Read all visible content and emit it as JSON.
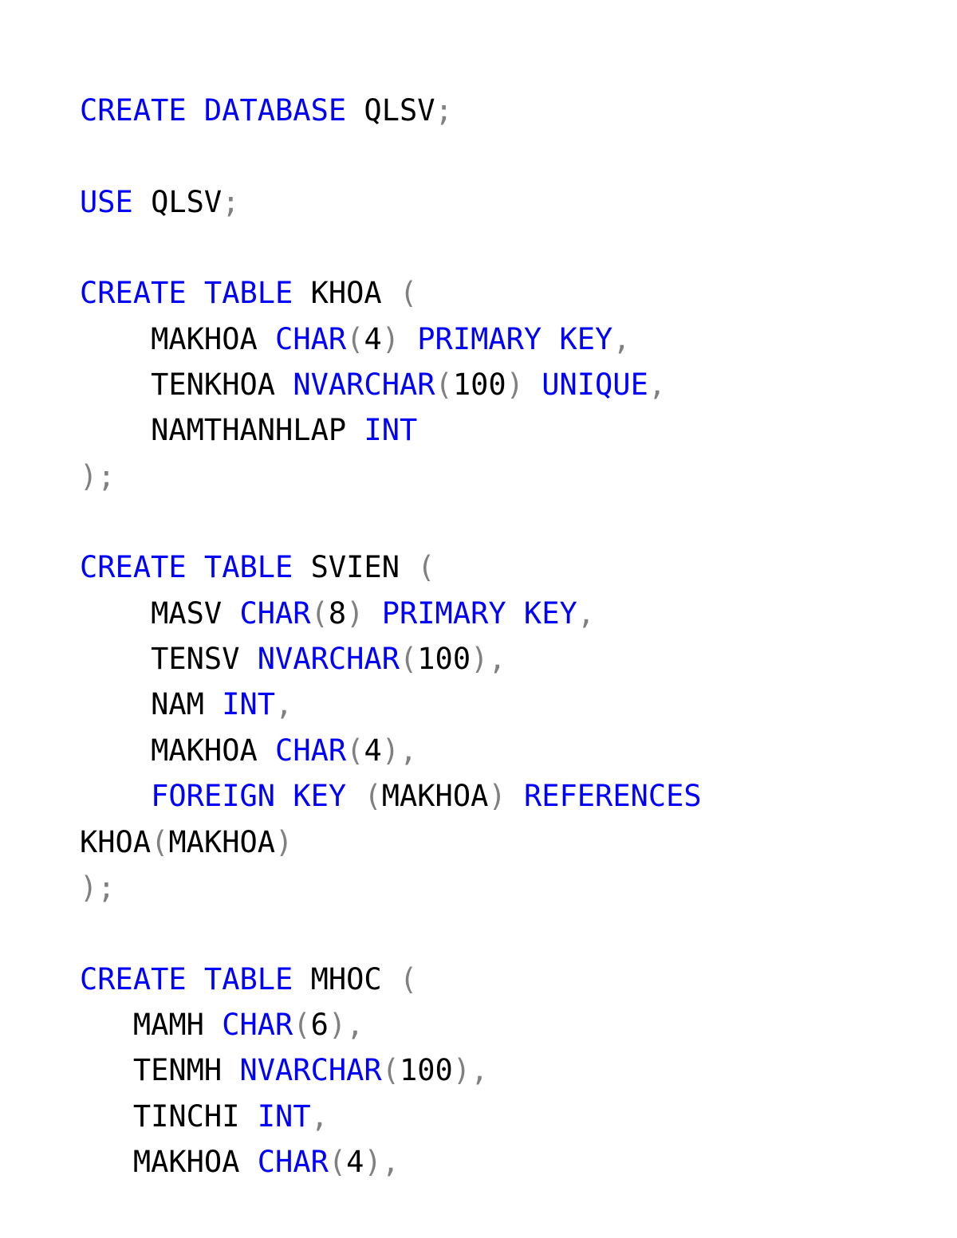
{
  "tokens": [
    [
      [
        "CREATE DATABASE",
        "kw"
      ],
      [
        " QLSV",
        "id"
      ],
      [
        ";",
        "pn"
      ]
    ],
    [],
    [
      [
        "USE",
        "kw"
      ],
      [
        " QLSV",
        "id"
      ],
      [
        ";",
        "pn"
      ]
    ],
    [],
    [
      [
        "CREATE TABLE",
        "kw"
      ],
      [
        " KHOA ",
        "id"
      ],
      [
        "(",
        "pn"
      ]
    ],
    [
      [
        "    MAKHOA ",
        "id"
      ],
      [
        "CHAR",
        "kw"
      ],
      [
        "(",
        "pn"
      ],
      [
        "4",
        "id"
      ],
      [
        ")",
        "pn"
      ],
      [
        " ",
        "id"
      ],
      [
        "PRIMARY KEY",
        "kw"
      ],
      [
        ",",
        "pn"
      ]
    ],
    [
      [
        "    TENKHOA ",
        "id"
      ],
      [
        "NVARCHAR",
        "kw"
      ],
      [
        "(",
        "pn"
      ],
      [
        "100",
        "id"
      ],
      [
        ")",
        "pn"
      ],
      [
        " ",
        "id"
      ],
      [
        "UNIQUE",
        "kw"
      ],
      [
        ",",
        "pn"
      ]
    ],
    [
      [
        "    NAMTHANHLAP ",
        "id"
      ],
      [
        "INT",
        "kw"
      ]
    ],
    [
      [
        ");",
        "pn"
      ]
    ],
    [],
    [
      [
        "CREATE TABLE",
        "kw"
      ],
      [
        " SVIEN ",
        "id"
      ],
      [
        "(",
        "pn"
      ]
    ],
    [
      [
        "    MASV ",
        "id"
      ],
      [
        "CHAR",
        "kw"
      ],
      [
        "(",
        "pn"
      ],
      [
        "8",
        "id"
      ],
      [
        ")",
        "pn"
      ],
      [
        " ",
        "id"
      ],
      [
        "PRIMARY KEY",
        "kw"
      ],
      [
        ",",
        "pn"
      ]
    ],
    [
      [
        "    TENSV ",
        "id"
      ],
      [
        "NVARCHAR",
        "kw"
      ],
      [
        "(",
        "pn"
      ],
      [
        "100",
        "id"
      ],
      [
        "),",
        "pn"
      ]
    ],
    [
      [
        "    NAM ",
        "id"
      ],
      [
        "INT",
        "kw"
      ],
      [
        ",",
        "pn"
      ]
    ],
    [
      [
        "    MAKHOA ",
        "id"
      ],
      [
        "CHAR",
        "kw"
      ],
      [
        "(",
        "pn"
      ],
      [
        "4",
        "id"
      ],
      [
        "),",
        "pn"
      ]
    ],
    [
      [
        "    ",
        "id"
      ],
      [
        "FOREIGN KEY",
        "kw"
      ],
      [
        " ",
        "id"
      ],
      [
        "(",
        "pn"
      ],
      [
        "MAKHOA",
        "id"
      ],
      [
        ")",
        "pn"
      ],
      [
        " ",
        "id"
      ],
      [
        "REFERENCES",
        "kw"
      ]
    ],
    [
      [
        "KHOA",
        "id"
      ],
      [
        "(",
        "pn"
      ],
      [
        "MAKHOA",
        "id"
      ],
      [
        ")",
        "pn"
      ]
    ],
    [
      [
        ");",
        "pn"
      ]
    ],
    [],
    [
      [
        "CREATE TABLE",
        "kw"
      ],
      [
        " MHOC ",
        "id"
      ],
      [
        "(",
        "pn"
      ]
    ],
    [
      [
        "   MAMH ",
        "id"
      ],
      [
        "CHAR",
        "kw"
      ],
      [
        "(",
        "pn"
      ],
      [
        "6",
        "id"
      ],
      [
        "),",
        "pn"
      ]
    ],
    [
      [
        "   TENMH ",
        "id"
      ],
      [
        "NVARCHAR",
        "kw"
      ],
      [
        "(",
        "pn"
      ],
      [
        "100",
        "id"
      ],
      [
        "),",
        "pn"
      ]
    ],
    [
      [
        "   TINCHI ",
        "id"
      ],
      [
        "INT",
        "kw"
      ],
      [
        ",",
        "pn"
      ]
    ],
    [
      [
        "   MAKHOA ",
        "id"
      ],
      [
        "CHAR",
        "kw"
      ],
      [
        "(",
        "pn"
      ],
      [
        "4",
        "id"
      ],
      [
        "),",
        "pn"
      ]
    ]
  ]
}
